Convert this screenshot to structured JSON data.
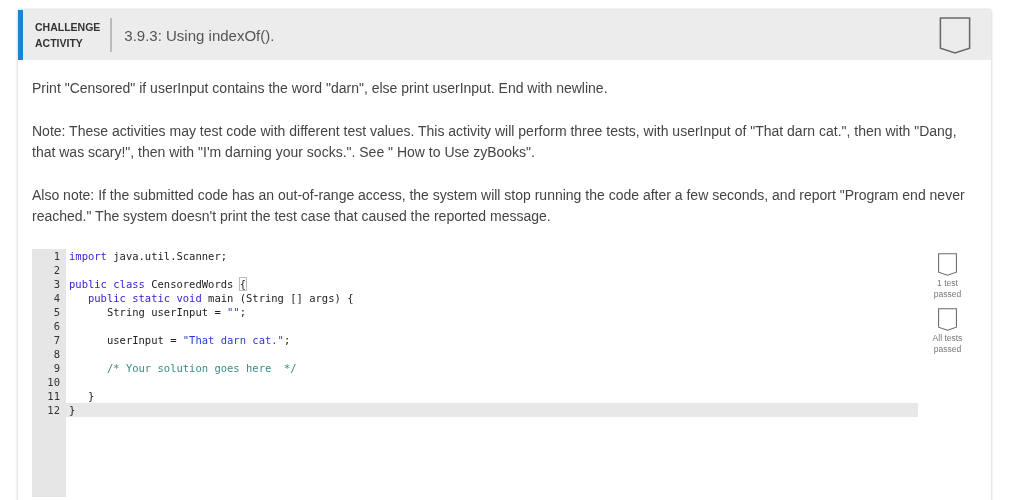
{
  "header": {
    "label_line_1": "CHALLENGE",
    "label_line_2": "ACTIVITY",
    "title": "3.9.3: Using indexOf().",
    "completed": false
  },
  "paragraphs": [
    "Print \"Censored\" if userInput contains the word \"darn\", else print userInput. End with newline.",
    "Note: These activities may test code with different test values. This activity will perform three tests, with userInput of \"That darn cat.\", then with \"Dang, that was scary!\", then with \"I'm darning your socks.\". See \" How to Use zyBooks\".",
    "Also note: If the submitted code has an out-of-range access, the system will stop running the code after a few seconds, and report \"Program end never reached.\" The system doesn't print the test case that caused the reported message."
  ],
  "editor": {
    "lines": [
      {
        "number": "1",
        "active": false,
        "tokens": [
          {
            "kind": "keyword",
            "text": "import"
          },
          {
            "kind": "plain",
            "text": " java.util.Scanner;"
          }
        ]
      },
      {
        "number": "2",
        "active": false
      },
      {
        "number": "3",
        "active": false,
        "tokens": [
          {
            "kind": "keyword",
            "text": "public class"
          },
          {
            "kind": "plain",
            "text": " CensoredWords "
          },
          {
            "kind": "bracket",
            "text": "{"
          }
        ]
      },
      {
        "number": "4",
        "active": false,
        "tokens": [
          {
            "kind": "keyword",
            "text": "   public static void"
          },
          {
            "kind": "plain",
            "text": " main (String [] args) {"
          }
        ]
      },
      {
        "number": "5",
        "active": false,
        "tokens": [
          {
            "kind": "plain",
            "text": "      String userInput = "
          },
          {
            "kind": "string",
            "text": "\"\""
          },
          {
            "kind": "plain",
            "text": ";"
          }
        ]
      },
      {
        "number": "6",
        "active": false
      },
      {
        "number": "7",
        "active": false,
        "tokens": [
          {
            "kind": "plain",
            "text": "      userInput = "
          },
          {
            "kind": "string",
            "text": "\"That darn cat.\""
          },
          {
            "kind": "plain",
            "text": ";"
          }
        ]
      },
      {
        "number": "8",
        "active": false
      },
      {
        "number": "9",
        "active": false,
        "tokens": [
          {
            "kind": "comment",
            "text": "      /* Your solution goes here  */"
          }
        ]
      },
      {
        "number": "10",
        "active": false
      },
      {
        "number": "11",
        "active": false,
        "tokens": [
          {
            "kind": "plain",
            "text": "   }"
          }
        ]
      },
      {
        "number": "12",
        "active": true,
        "tokens": [
          {
            "kind": "plain",
            "text": "}"
          }
        ]
      }
    ]
  },
  "tests": [
    {
      "label_line_1": "1 test",
      "label_line_2": "passed",
      "passed": false
    },
    {
      "label_line_1": "All tests",
      "label_line_2": "passed",
      "passed": false
    }
  ]
}
